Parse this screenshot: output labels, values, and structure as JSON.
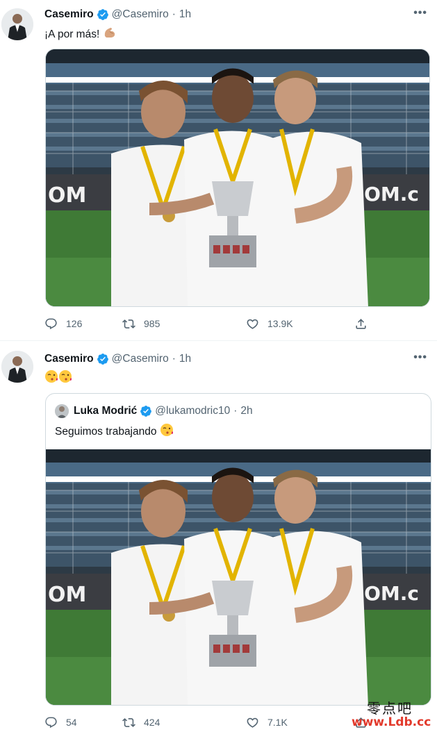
{
  "tweets": [
    {
      "author": {
        "name": "Casemiro",
        "handle": "@Casemiro",
        "time": "1h",
        "verified": true
      },
      "text": "¡A por más! ",
      "text_emoji": "flexed-biceps",
      "media": {
        "description_icon": "photo-trophy-team"
      },
      "stats": {
        "replies": "126",
        "retweets": "985",
        "likes": "13.9K"
      }
    },
    {
      "author": {
        "name": "Casemiro",
        "handle": "@Casemiro",
        "time": "1h",
        "verified": true
      },
      "text_emoji": "kissing-face-x2",
      "quoted": {
        "author": {
          "name": "Luka Modrić",
          "handle": "@lukamodric10",
          "time": "2h",
          "verified": true
        },
        "text": "Seguimos trabajando "
      },
      "stats": {
        "replies": "54",
        "retweets": "424",
        "likes": "7.1K"
      }
    }
  ],
  "separator": "·",
  "more_label": "•••",
  "watermark": {
    "chinese": "零点吧",
    "url": "www.Ldb.cc"
  },
  "colors": {
    "verified": "#1d9bf0",
    "muted": "#536471",
    "border": "#cfd9de",
    "watermark_url": "#e23a2c"
  }
}
